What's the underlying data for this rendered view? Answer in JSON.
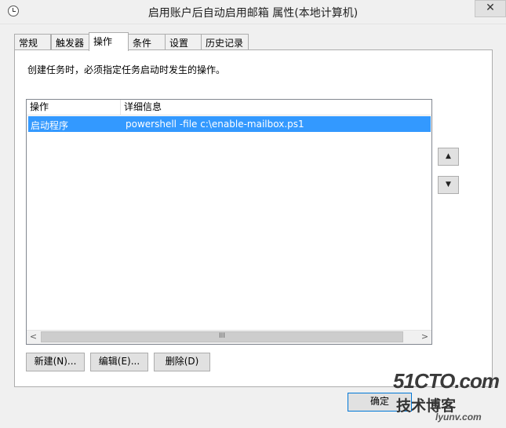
{
  "window": {
    "title": "启用账户后自动启用邮箱 属性(本地计算机)",
    "close_glyph": "✕"
  },
  "tabs": [
    {
      "label": "常规"
    },
    {
      "label": "触发器"
    },
    {
      "label": "操作"
    },
    {
      "label": "条件"
    },
    {
      "label": "设置"
    },
    {
      "label": "历史记录"
    }
  ],
  "active_tab": "操作",
  "panel": {
    "description": "创建任务时，必须指定任务启动时发生的操作。",
    "list": {
      "columns": [
        "操作",
        "详细信息"
      ],
      "rows": [
        {
          "action": "启动程序",
          "details": "powershell -file c:\\enable-mailbox.ps1",
          "selected": true
        }
      ],
      "scroll_left": "<",
      "scroll_right": ">",
      "scroll_grip": "III"
    },
    "move_up": "▲",
    "move_down": "▼",
    "buttons": {
      "new": "新建(N)...",
      "edit": "编辑(E)...",
      "delete": "删除(D)"
    }
  },
  "footer": {
    "ok": "确定"
  },
  "watermark": {
    "line1": "51CTO.com",
    "line2": "技术博客",
    "line3": "lyunv.com"
  },
  "colors": {
    "selection": "#3399ff",
    "window_bg": "#f0f0f0",
    "border": "#adadad"
  }
}
